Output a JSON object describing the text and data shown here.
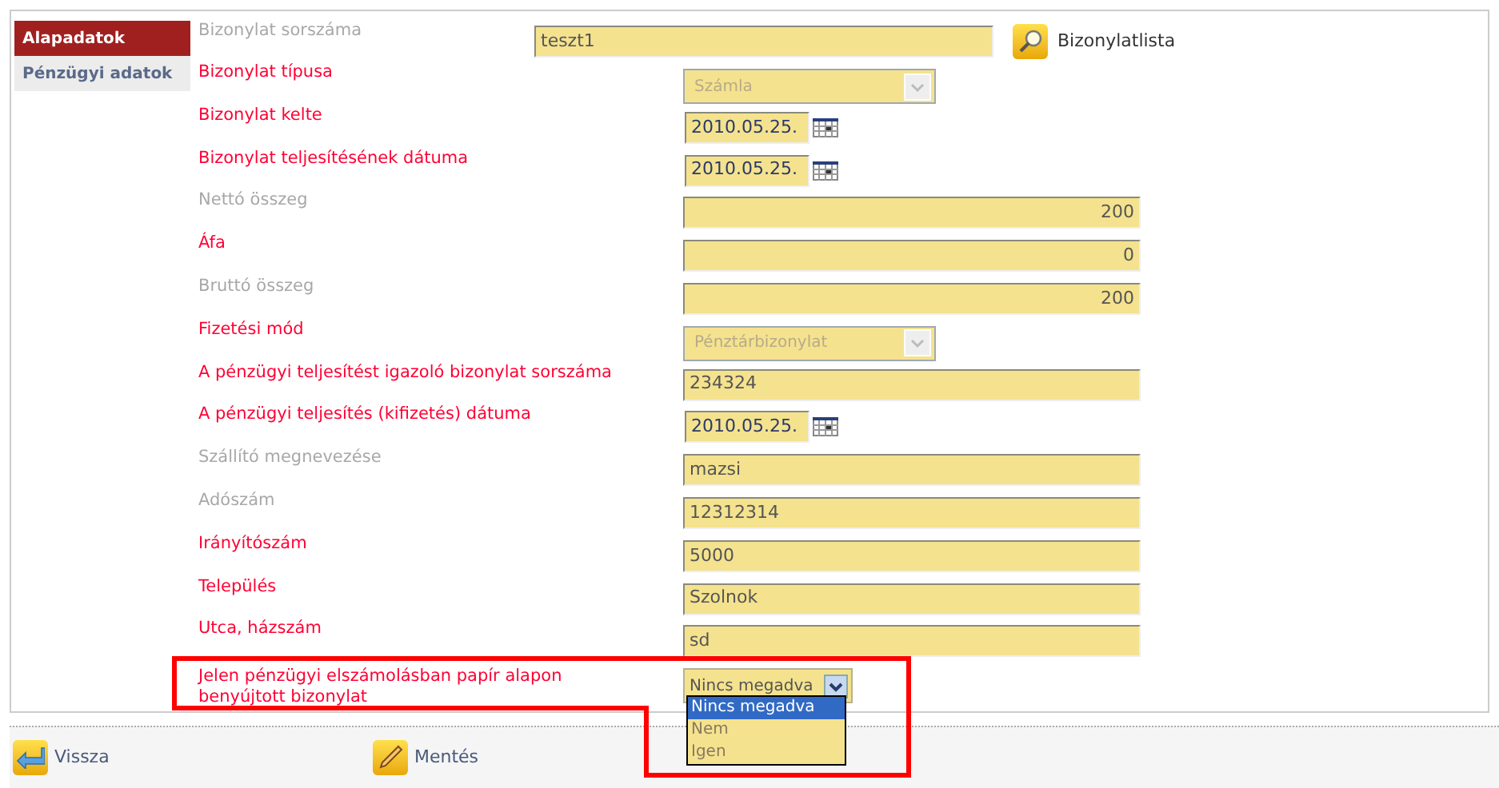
{
  "sidebar": {
    "tabs": [
      {
        "label": "Alapadatok",
        "selected": true
      },
      {
        "label": "Pénzügyi adatok",
        "selected": false
      }
    ]
  },
  "form": {
    "rows": [
      {
        "label": "Bizonylat sorszáma",
        "required": false,
        "kind": "search",
        "value": "teszt1",
        "button": "Bizonylatlista"
      },
      {
        "label": "Bizonylat típusa",
        "required": true,
        "kind": "select",
        "value": "Számla"
      },
      {
        "label": "Bizonylat kelte",
        "required": true,
        "kind": "date",
        "value": "2010.05.25."
      },
      {
        "label": "Bizonylat teljesítésének dátuma",
        "required": true,
        "kind": "date",
        "value": "2010.05.25."
      },
      {
        "label": "Nettó összeg",
        "required": false,
        "kind": "number",
        "value": "200"
      },
      {
        "label": "Áfa",
        "required": true,
        "kind": "number",
        "value": "0"
      },
      {
        "label": "Bruttó összeg",
        "required": false,
        "kind": "number",
        "value": "200"
      },
      {
        "label": "Fizetési mód",
        "required": true,
        "kind": "select",
        "value": "Pénztárbizonylat"
      },
      {
        "label": "A pénzügyi teljesítést igazoló bizonylat sorszáma",
        "required": true,
        "kind": "text",
        "value": "234324"
      },
      {
        "label": "A pénzügyi teljesítés (kifizetés) dátuma",
        "required": true,
        "kind": "date",
        "value": "2010.05.25."
      },
      {
        "label": "Szállító megnevezése",
        "required": false,
        "kind": "text",
        "value": "mazsi"
      },
      {
        "label": "Adószám",
        "required": false,
        "kind": "text",
        "value": "12312314"
      },
      {
        "label": "Irányítószám",
        "required": true,
        "kind": "text",
        "value": "5000"
      },
      {
        "label": "Település",
        "required": true,
        "kind": "text",
        "value": "Szolnok"
      },
      {
        "label": "Utca, házszám",
        "required": true,
        "kind": "text",
        "value": "sd"
      },
      {
        "label": "Jelen pénzügyi elszámolásban papír alapon benyújtott bizonylat",
        "required": true,
        "kind": "dropdown",
        "value": "Nincs megadva",
        "options": [
          {
            "label": "Nincs megadva",
            "selected": true
          },
          {
            "label": "Nem",
            "selected": false
          },
          {
            "label": "Igen",
            "selected": false
          }
        ]
      }
    ]
  },
  "footer": {
    "buttons": [
      {
        "label": "Vissza",
        "kind": "back"
      },
      {
        "label": "Mentés",
        "kind": "save"
      }
    ]
  }
}
